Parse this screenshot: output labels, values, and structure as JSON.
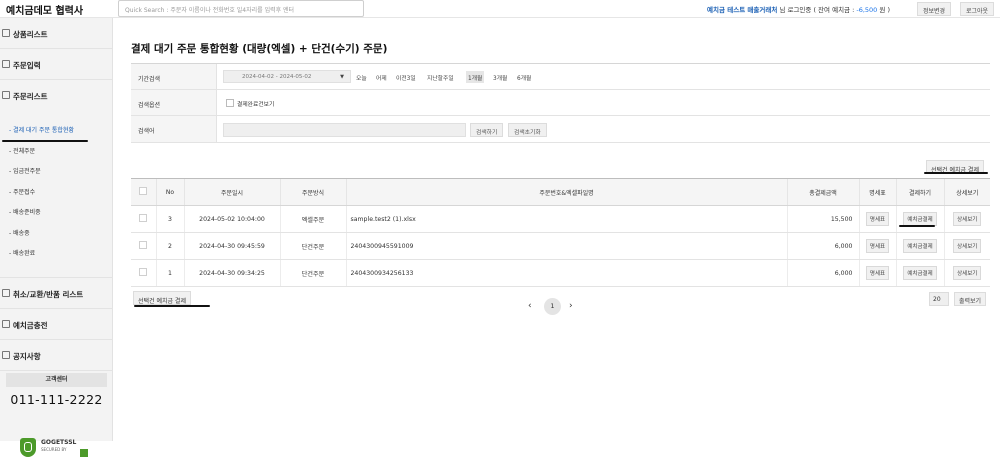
{
  "header": {
    "logo": "예치금데모 협력사",
    "search_placeholder": "Quick Search : 주문자 이름이나 전화번호 일4자리를 입력후 엔터",
    "user_name": "예치금 테스트 매출거래처",
    "login_text": "님 로그인중 ( 잔여 예치금 :",
    "balance": "-6,500",
    "balance_unit": "원 )",
    "edit_info": "정보변경",
    "logout": "로그아웃"
  },
  "sidebar": {
    "sections": [
      {
        "label": "상품리스트"
      },
      {
        "label": "주문입력"
      },
      {
        "label": "주문리스트"
      }
    ],
    "order_items": [
      {
        "label": "- 결제 대기 주문 통합현황"
      },
      {
        "label": "- 전체주문"
      },
      {
        "label": "- 입금전주문"
      },
      {
        "label": "- 주문접수"
      },
      {
        "label": "- 배송준비중"
      },
      {
        "label": "- 배송중"
      },
      {
        "label": "- 배송완료"
      }
    ],
    "bottom_sections": [
      {
        "label": "취소/교환/반품 리스트"
      },
      {
        "label": "예치금충전"
      },
      {
        "label": "공지사항"
      }
    ],
    "support_title": "고객센터",
    "support_phone": "011-111-2222",
    "ssl_name": "GOGETSSL",
    "ssl_sub": "SECURED BY"
  },
  "page": {
    "title": "결제 대기 주문 통합현황 (대량(엑셀) + 단건(수기) 주문)"
  },
  "filters": {
    "period_label": "기간검색",
    "date_range": "2024-04-02 - 2024-05-02",
    "period_options": [
      "오늘",
      "어제",
      "이전3일",
      "지난할주일",
      "1개월",
      "3개월",
      "6개월"
    ],
    "active_period": "1개월",
    "option_label": "검색옵션",
    "option_checkbox": "결제완료건보기",
    "keyword_label": "검색어",
    "keyword_value": "",
    "search_button": "검색하기",
    "reset_button": "검색초기화"
  },
  "actions": {
    "pay_selected": "선택건 예치금 결제"
  },
  "table": {
    "headers": [
      "",
      "No",
      "주문일시",
      "주문방식",
      "주문번호&엑셀파일명",
      "총결제금액",
      "명세표",
      "결제하기",
      "상세보기"
    ],
    "rows": [
      {
        "no": "3",
        "date": "2024-05-02 10:04:00",
        "method": "엑셀주문",
        "order": "sample.test2 (1).xlsx",
        "amount": "15,500",
        "statement": "명세표",
        "pay": "예치금결제",
        "detail": "상세보기"
      },
      {
        "no": "2",
        "date": "2024-04-30 09:45:59",
        "method": "단건주문",
        "order": "2404300945591009",
        "amount": "6,000",
        "statement": "명세표",
        "pay": "예치금결제",
        "detail": "상세보기"
      },
      {
        "no": "1",
        "date": "2024-04-30 09:34:25",
        "method": "단건주문",
        "order": "2404300934256133",
        "amount": "6,000",
        "statement": "명세표",
        "pay": "예치금결제",
        "detail": "상세보기"
      }
    ]
  },
  "pagination": {
    "prev": "‹",
    "current": "1",
    "next": "›",
    "page_size": "20",
    "print_button": "출력보기"
  }
}
